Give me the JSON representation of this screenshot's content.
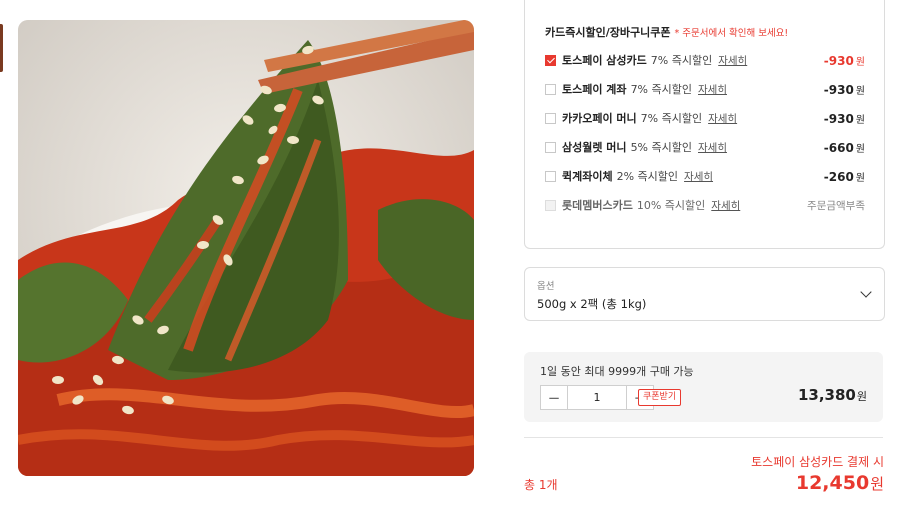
{
  "coupon": {
    "title": "카드즉시할인/장바구니쿠폰",
    "note": "* 주문서에서 확인해 보세요!",
    "items": [
      {
        "name": "토스페이 삼성카드",
        "desc": "7% 즉시할인",
        "detail": "자세히",
        "amount": "-930",
        "unit": "원",
        "checked": true
      },
      {
        "name": "토스페이 계좌",
        "desc": "7% 즉시할인",
        "detail": "자세히",
        "amount": "-930",
        "unit": "원",
        "checked": false
      },
      {
        "name": "카카오페이 머니",
        "desc": "7% 즉시할인",
        "detail": "자세히",
        "amount": "-930",
        "unit": "원",
        "checked": false
      },
      {
        "name": "삼성월렛 머니",
        "desc": "5% 즉시할인",
        "detail": "자세히",
        "amount": "-660",
        "unit": "원",
        "checked": false
      },
      {
        "name": "퀵계좌이체",
        "desc": "2% 즉시할인",
        "detail": "자세히",
        "amount": "-260",
        "unit": "원",
        "checked": false
      },
      {
        "name": "롯데멤버스카드",
        "desc": "10% 즉시할인",
        "detail": "자세히",
        "amount": "주문금액부족",
        "unit": "",
        "checked": false,
        "disabled": true
      }
    ]
  },
  "option": {
    "label": "옵션",
    "value": "500g x 2팩 (총 1kg)"
  },
  "quantity": {
    "limit_text": "1일 동안 최대 9999개 구매 가능",
    "minus": "−",
    "value": "1",
    "plus": "+",
    "coupon_button": "쿠폰받기",
    "price": "13,380",
    "price_unit": "원"
  },
  "total": {
    "label": "총 1개",
    "pay_note": "토스페이 삼성카드 결제 시",
    "final_price": "12,450",
    "final_unit": "원"
  },
  "colors": {
    "accent": "#e8392f",
    "kimchi": "#d63a1c",
    "leaf": "#4e6b2a"
  }
}
